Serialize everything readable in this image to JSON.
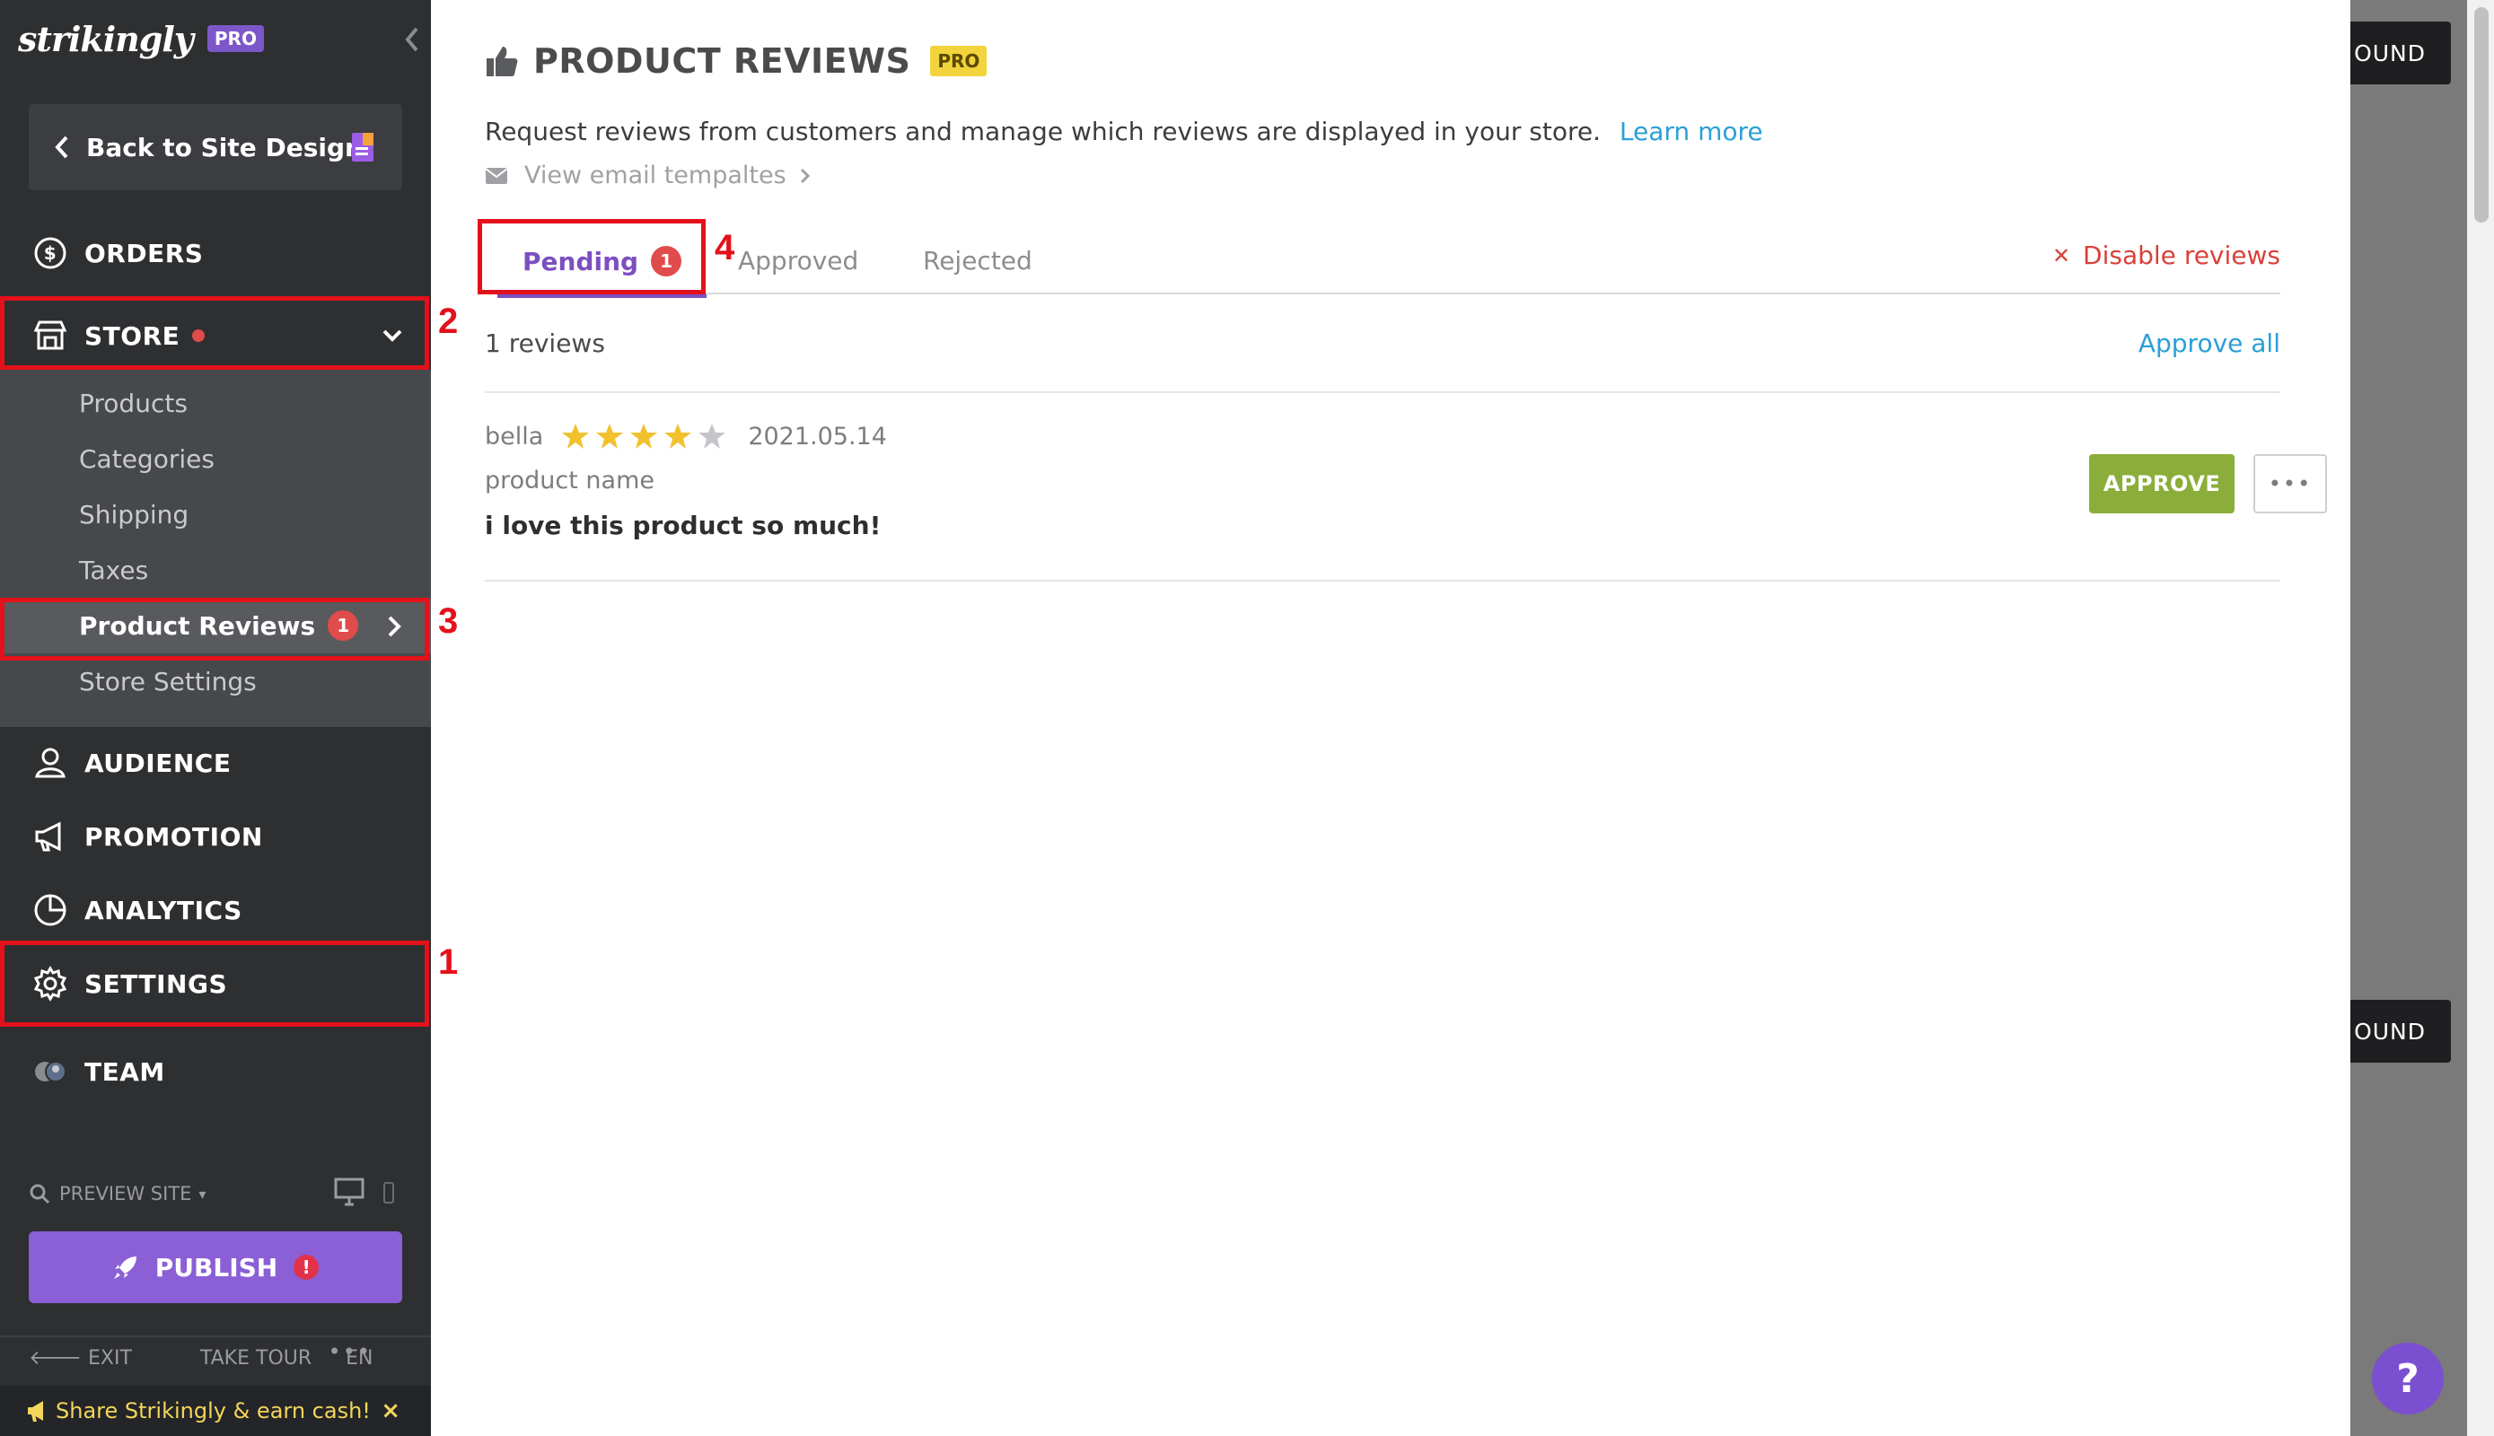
{
  "sidebar": {
    "logo": "strikingly",
    "pro_badge": "PRO",
    "back_label": "Back to Site Design",
    "nav": {
      "orders": "ORDERS",
      "store": "STORE",
      "audience": "AUDIENCE",
      "promotion": "PROMOTION",
      "analytics": "ANALYTICS",
      "settings": "SETTINGS",
      "team": "TEAM"
    },
    "store_submenu": {
      "products": "Products",
      "categories": "Categories",
      "shipping": "Shipping",
      "taxes": "Taxes",
      "product_reviews": "Product Reviews",
      "product_reviews_count": "1",
      "store_settings": "Store Settings"
    },
    "preview_site": "PREVIEW SITE",
    "publish": "PUBLISH",
    "publish_alert": "!",
    "bottom": {
      "exit": "EXIT",
      "take_tour": "TAKE TOUR",
      "language": "EN",
      "more": "•••"
    },
    "share_bar": {
      "text": "Share Strikingly & earn cash!",
      "close": "×"
    }
  },
  "annotations": {
    "n1": "1",
    "n2": "2",
    "n3": "3",
    "n4": "4"
  },
  "main": {
    "title": "PRODUCT REVIEWS",
    "pro_tag": "PRO",
    "description": "Request reviews from customers and manage which reviews are displayed in your store.",
    "learn_more": "Learn more",
    "email_templates": "View email tempaltes",
    "tabs": {
      "pending": "Pending",
      "pending_count": "1",
      "approved": "Approved",
      "rejected": "Rejected"
    },
    "disable_reviews": "Disable reviews",
    "review_count": "1 reviews",
    "approve_all": "Approve all",
    "reviews": [
      {
        "author": "bella",
        "rating": 4,
        "max_rating": 5,
        "date": "2021.05.14",
        "product": "product name",
        "text": "i love this product so much!",
        "approve_label": "APPROVE",
        "more_label": "•••"
      }
    ]
  },
  "right_overlay": {
    "button_top": "OUND",
    "button_bottom": "OUND",
    "help": "?"
  },
  "colors": {
    "sidebar_bg": "#2e2f31",
    "accent_purple": "#7c4fc0",
    "link_blue": "#2a9fd6",
    "approve_green": "#8bae3a",
    "annotation_red": "#e3111b",
    "star_gold": "#f2c12e"
  }
}
